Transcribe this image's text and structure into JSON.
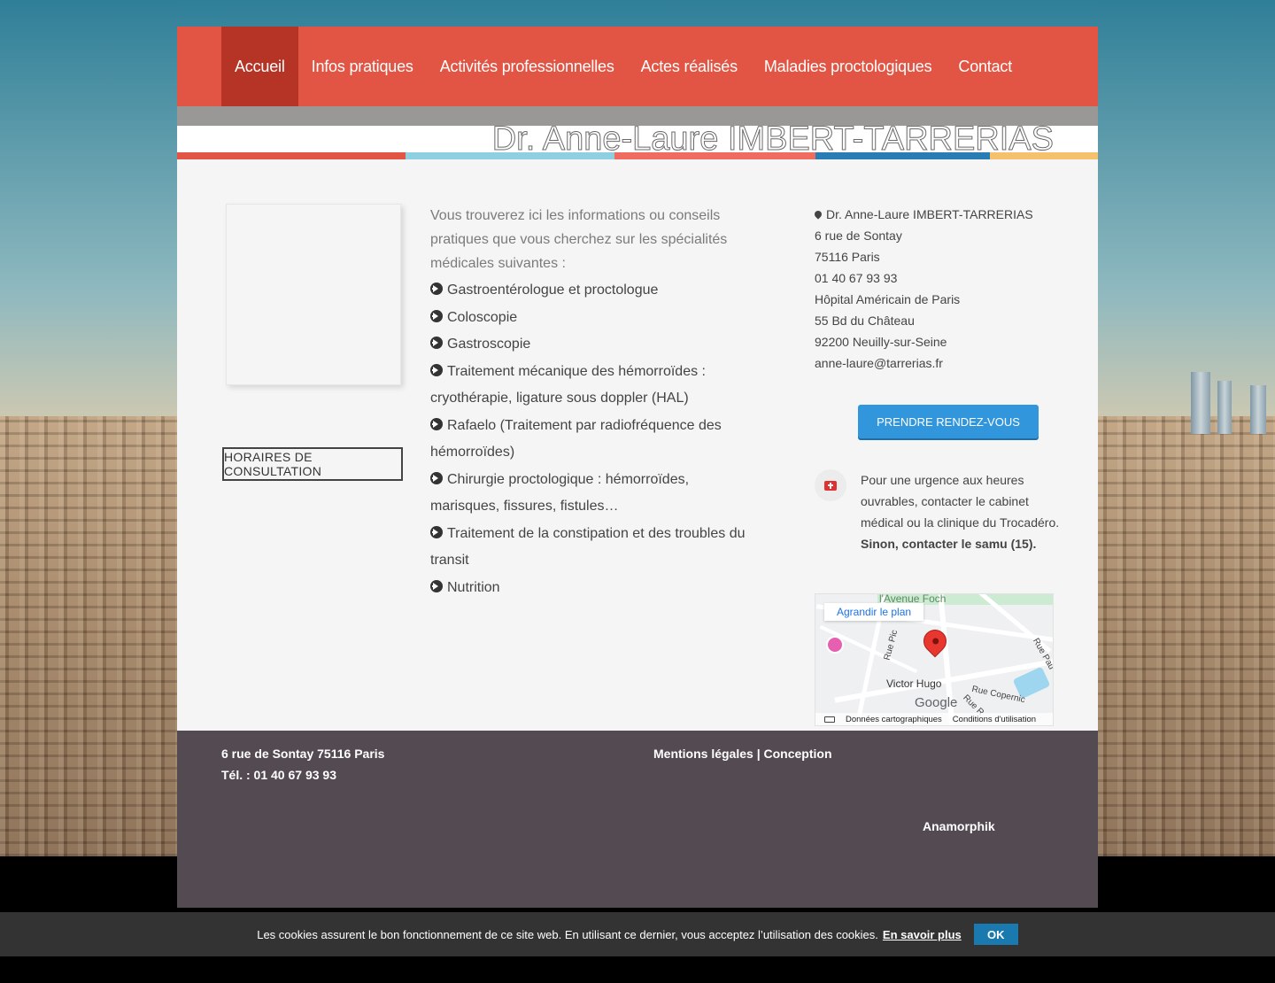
{
  "colors": {
    "nav_bg": "#e25544",
    "nav_active": "#b53425",
    "footer_bg": "#544b52",
    "button_blue": "#3296dc",
    "cookie_bg": "#333333",
    "bar": [
      "#e25544",
      "#8ecfe0",
      "#f06b60",
      "#2a7db4",
      "#f5c16c"
    ]
  },
  "nav": {
    "items": [
      {
        "label": "Accueil",
        "active": true
      },
      {
        "label": "Infos pratiques"
      },
      {
        "label": "Activités professionnelles"
      },
      {
        "label": "Actes réalisés"
      },
      {
        "label": "Maladies proctologiques"
      },
      {
        "label": "Contact"
      }
    ]
  },
  "header": {
    "title": "Dr. Anne-Laure IMBERT-TARRERIAS"
  },
  "left": {
    "hours_button": "HORAIRES DE CONSULTATION"
  },
  "content": {
    "intro": "Vous trouverez ici les informations ou conseils pratiques que vous cherchez sur les spécialités médicales suivantes :",
    "specialties": [
      "Gastroentérologue et proctologue",
      "Coloscopie",
      "Gastroscopie",
      "Traitement mécanique des hémorroïdes : cryothérapie, ligature sous doppler (HAL)",
      "Rafaelo (Traitement par radiofréquence des hémorroïdes)",
      "Chirurgie proctologique : hémorroïdes, marisques, fissures, fistules…",
      "Traitement de la constipation et des troubles du transit",
      "Nutrition"
    ]
  },
  "contact": {
    "name": "Dr. Anne-Laure IMBERT-TARRERIAS",
    "lines": [
      "6 rue de Sontay",
      "75116 Paris",
      "01 40 67 93 93",
      "Hôpital Américain de Paris",
      "55 Bd du Château",
      "92200 Neuilly-sur-Seine",
      "anne-laure@tarrerias.fr"
    ],
    "rdv_button": "PRENDRE RENDEZ-VOUS",
    "urgence_text": "Pour une urgence aux heures ouvrables, contacter le cabinet médical ou la clinique du Trocadéro.",
    "urgence_strong": "Sinon, contacter le samu (15)."
  },
  "map": {
    "agrandir": "Agrandir le plan",
    "labels": [
      "l'Avenue Foch",
      "Victor Hugo",
      "Rue Copernic",
      "Rue Pic",
      "Rue Pau",
      "Rue R"
    ],
    "brand": "Google",
    "attribution": [
      "Données cartographiques",
      "Conditions d'utilisation"
    ]
  },
  "footer": {
    "address": "6 rue de Sontay 75116 Paris",
    "phone": "Tél. : 01 40 67 93 93",
    "mentions": "Mentions légales",
    "separator": " | ",
    "conception": "Conception",
    "credit": "Anamorphik"
  },
  "cookie": {
    "text": "Les cookies assurent le bon fonctionnement de ce site web. En utilisant ce dernier, vous acceptez l’utilisation des cookies.",
    "more": "En savoir plus",
    "ok": "OK"
  }
}
